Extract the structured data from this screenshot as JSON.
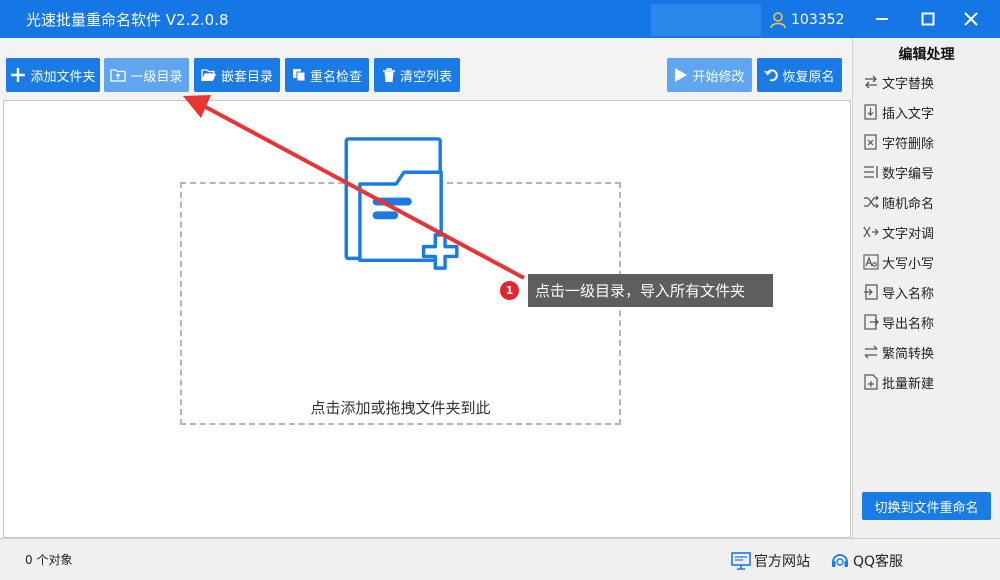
{
  "window": {
    "title": "光速批量重命名软件 V2.2.0.8",
    "user_id": "103352",
    "accent": "#1577e6"
  },
  "toolbar": {
    "add_folder": "添加文件夹",
    "level_one_dir": "一级目录",
    "nested_dir": "嵌套目录",
    "duplicate_check": "重名检查",
    "clear_list": "清空列表",
    "start_modify": "开始修改",
    "restore_name": "恢复原名"
  },
  "main": {
    "drop_hint": "点击添加或拖拽文件夹到此"
  },
  "annotation": {
    "step": "1",
    "text": "点击一级目录，导入所有文件夹",
    "color": "#e1262d"
  },
  "sidebar": {
    "heading": "编辑处理",
    "items": [
      {
        "label": "文字替换",
        "icon": "swap-icon"
      },
      {
        "label": "插入文字",
        "icon": "insert-icon"
      },
      {
        "label": "字符删除",
        "icon": "delete-char-icon"
      },
      {
        "label": "数字编号",
        "icon": "numbering-icon"
      },
      {
        "label": "随机命名",
        "icon": "shuffle-icon"
      },
      {
        "label": "文字对调",
        "icon": "exchange-icon"
      },
      {
        "label": "大写小写",
        "icon": "case-icon"
      },
      {
        "label": "导入名称",
        "icon": "import-icon"
      },
      {
        "label": "导出名称",
        "icon": "export-icon"
      },
      {
        "label": "繁简转换",
        "icon": "convert-icon"
      },
      {
        "label": "批量新建",
        "icon": "batch-new-icon"
      }
    ],
    "switch_button": "切换到文件重命名"
  },
  "status": {
    "object_count": "0 个对象",
    "official_site": "官方网站",
    "qq_service": "QQ客服"
  }
}
